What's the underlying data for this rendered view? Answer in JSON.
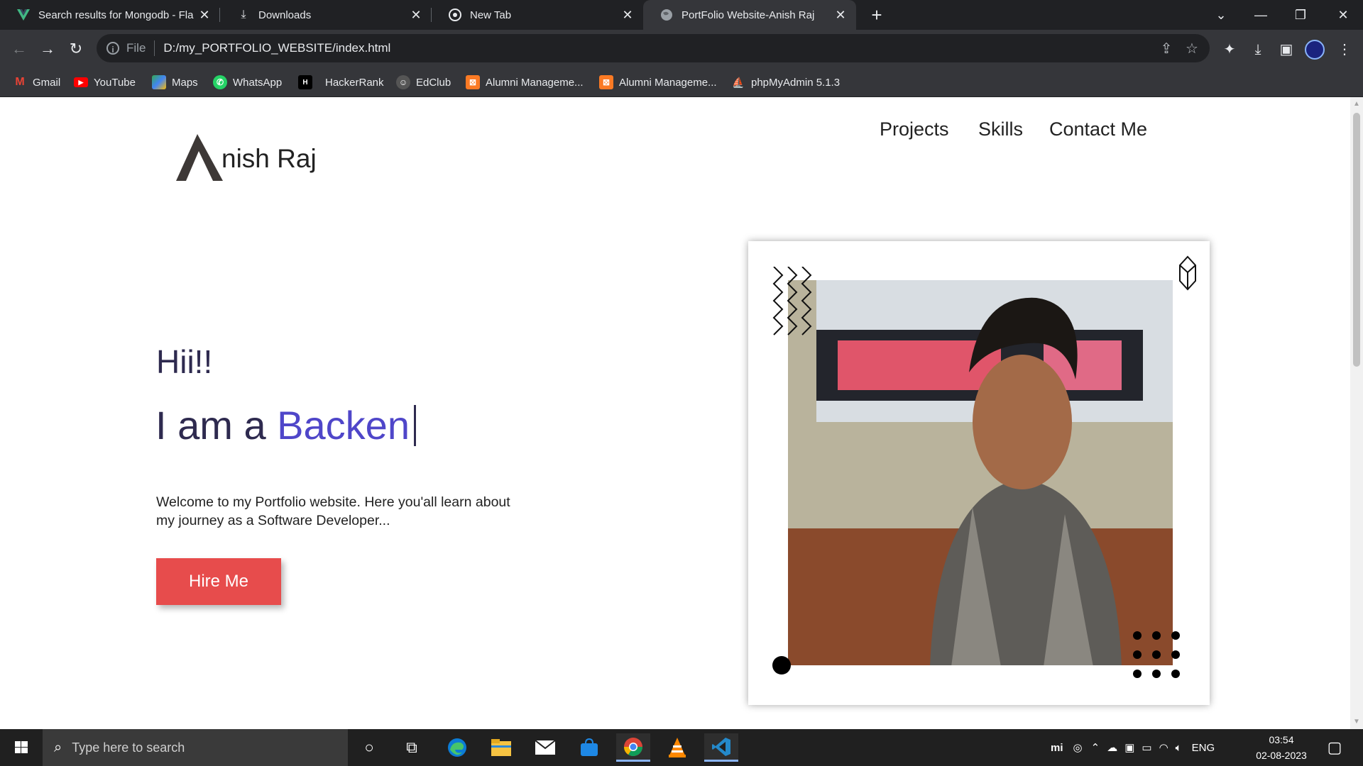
{
  "browser": {
    "tabs": [
      {
        "title": "Search results for Mongodb - Fla",
        "favicon": "vue-icon",
        "active": false
      },
      {
        "title": "Downloads",
        "favicon": "download-icon",
        "active": false
      },
      {
        "title": "New Tab",
        "favicon": "chrome-icon",
        "active": false
      },
      {
        "title": "PortFolio Website-Anish Raj",
        "favicon": "globe-icon",
        "active": true
      }
    ],
    "address": {
      "scheme": "File",
      "url": "D:/my_PORTFOLIO_WEBSITE/index.html"
    },
    "bookmarks": [
      {
        "label": "Gmail",
        "icon": "gmail-icon",
        "color": "#ea4335"
      },
      {
        "label": "YouTube",
        "icon": "youtube-icon",
        "color": "#ff0000"
      },
      {
        "label": "Maps",
        "icon": "maps-icon",
        "color": "#34a853"
      },
      {
        "label": "WhatsApp",
        "icon": "whatsapp-icon",
        "color": "#25d366"
      },
      {
        "label": "HackerRank",
        "icon": "hackerrank-icon",
        "color": "#000000"
      },
      {
        "label": "EdClub",
        "icon": "edclub-icon",
        "color": "#444444"
      },
      {
        "label": "Alumni Manageme...",
        "icon": "xampp-icon",
        "color": "#fb7a24"
      },
      {
        "label": "Alumni Manageme...",
        "icon": "xampp-icon",
        "color": "#fb7a24"
      },
      {
        "label": "phpMyAdmin 5.1.3",
        "icon": "phpmyadmin-icon",
        "color": "#f89c0e"
      }
    ]
  },
  "page": {
    "logo_initial": "A",
    "logo_name": "nish Raj",
    "nav": [
      "Projects",
      "Skills",
      "Contact Me"
    ],
    "greeting": "Hii!!",
    "intro_prefix": "I am a ",
    "intro_role": "Backen",
    "welcome": "Welcome to my Portfolio website. Here you'all learn about my journey as a Software Developer...",
    "hire_button": "Hire Me",
    "colors": {
      "accent": "#4f46c9",
      "button": "#e74c4c",
      "heading": "#2e2a4f"
    }
  },
  "taskbar": {
    "search_placeholder": "Type here to search",
    "apps": [
      "cortana-icon",
      "task-view-icon",
      "edge-icon",
      "file-explorer-icon",
      "mail-icon",
      "store-icon",
      "chrome-icon",
      "vlc-icon",
      "vscode-icon"
    ],
    "language": "ENG",
    "time": "03:54",
    "date": "02-08-2023"
  }
}
